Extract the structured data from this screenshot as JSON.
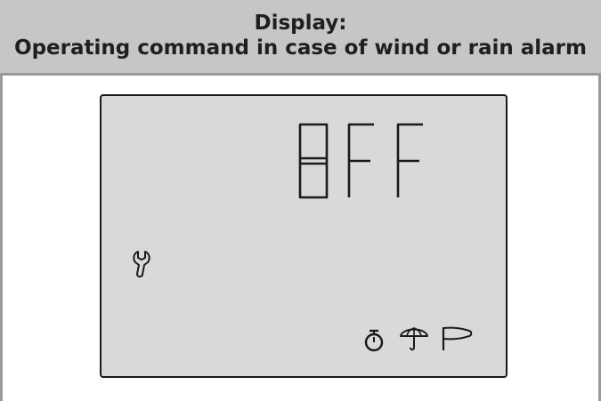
{
  "header": {
    "line1": "Display:",
    "line2": "Operating command in case of wind or rain alarm"
  },
  "display": {
    "text": "OFF",
    "icons": [
      "wrench-icon",
      "timer-icon",
      "umbrella-icon",
      "windsock-icon"
    ]
  },
  "colors": {
    "header_bg": "#c6c6c6",
    "border": "#9a9a9a",
    "lcd_bg": "#d9d9d9",
    "segment": "#1a1a1a"
  }
}
